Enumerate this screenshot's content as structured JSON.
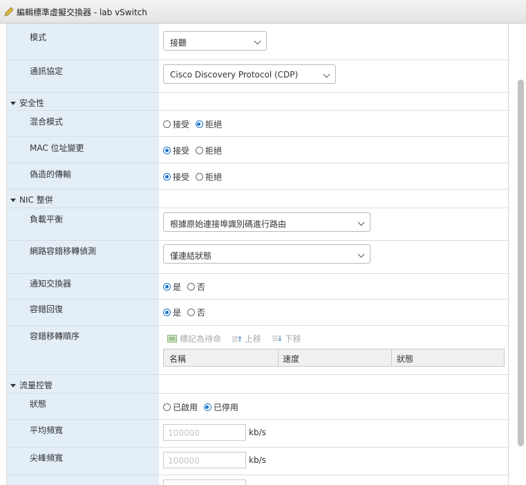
{
  "dialog": {
    "title": "編輯標準虛擬交換器 - lab vSwitch"
  },
  "rows": {
    "mode": {
      "label": "模式",
      "value": "接聽"
    },
    "protocol": {
      "label": "通訊協定",
      "value": "Cisco Discovery Protocol (CDP)"
    },
    "security": {
      "label": "安全性"
    },
    "promiscuous": {
      "label": "混合模式",
      "opt1": "接受",
      "opt2": "拒絕",
      "selected": "拒絕"
    },
    "mac_change": {
      "label": "MAC 位址變更",
      "opt1": "接受",
      "opt2": "拒絕",
      "selected": "接受"
    },
    "forged": {
      "label": "偽造的傳輸",
      "opt1": "接受",
      "opt2": "拒絕",
      "selected": "接受"
    },
    "nic": {
      "label": "NIC 整併"
    },
    "load_balance": {
      "label": "負載平衡",
      "value": "根據原始連接埠識別碼進行路由"
    },
    "failover_detect": {
      "label": "網路容錯移轉偵測",
      "value": "僅連結狀態"
    },
    "notify": {
      "label": "通知交換器",
      "opt1": "是",
      "opt2": "否",
      "selected": "是"
    },
    "failback": {
      "label": "容錯回復",
      "opt1": "是",
      "opt2": "否",
      "selected": "是"
    },
    "failover_order": {
      "label": "容錯移轉順序",
      "toolbar": {
        "mark_standby": "標記為待命",
        "move_up": "上移",
        "move_down": "下移"
      },
      "columns": [
        "名稱",
        "速度",
        "狀態"
      ]
    },
    "traffic": {
      "label": "流量控管"
    },
    "state": {
      "label": "狀態",
      "opt1": "已啟用",
      "opt2": "已停用",
      "selected": "已停用"
    },
    "avg_bandwidth": {
      "label": "平均頻寬",
      "placeholder": "100000",
      "unit": "kb/s"
    },
    "peak_bandwidth": {
      "label": "尖峰頻寬",
      "placeholder": "100000",
      "unit": "kb/s"
    }
  },
  "colors": {
    "label_bg": "#e3eef7",
    "accent": "#1a73c8"
  }
}
